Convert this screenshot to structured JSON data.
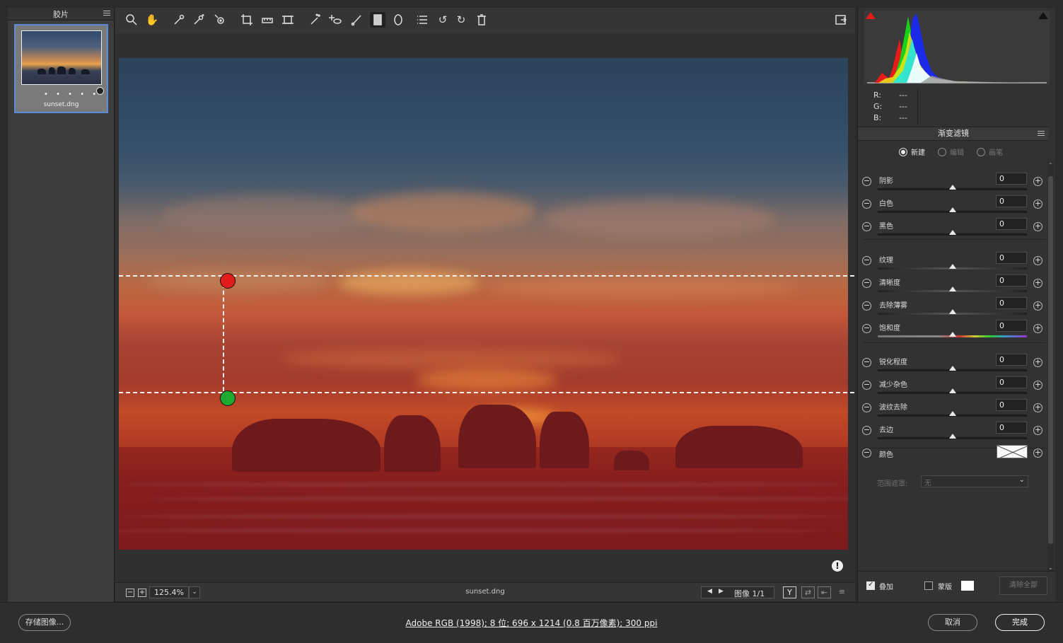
{
  "filmstrip": {
    "title": "胶片",
    "thumbnail": {
      "filename": "sunset.dng",
      "rating_dots": "• • • • •"
    }
  },
  "toolbar": {
    "tools": [
      {
        "name": "zoom-tool"
      },
      {
        "name": "hand-tool"
      },
      {
        "name": "white-balance-tool"
      },
      {
        "name": "color-sampler-tool"
      },
      {
        "name": "targeted-adjustment-tool"
      },
      {
        "name": "crop-tool"
      },
      {
        "name": "straighten-tool"
      },
      {
        "name": "transform-tool"
      },
      {
        "name": "spot-removal-tool"
      },
      {
        "name": "red-eye-tool"
      },
      {
        "name": "adjustment-brush-tool"
      },
      {
        "name": "graduated-filter-tool",
        "active": true
      },
      {
        "name": "radial-filter-tool"
      },
      {
        "name": "preferences-tool"
      },
      {
        "name": "rotate-left-tool"
      },
      {
        "name": "rotate-right-tool"
      },
      {
        "name": "delete-tool"
      }
    ]
  },
  "canvas": {
    "gradient": {
      "start_color": "#e21b1b",
      "end_color": "#1eaa2e"
    }
  },
  "statusbar": {
    "zoom": "125.4%",
    "filename": "sunset.dng",
    "image_counter": "图像 1/1",
    "view_mode_label": "Y"
  },
  "right_panel": {
    "rgb": {
      "r_label": "R:",
      "g_label": "G:",
      "b_label": "B:",
      "r": "---",
      "g": "---",
      "b": "---"
    },
    "panel_title": "渐变滤镜",
    "modes": [
      {
        "label": "新建",
        "selected": true
      },
      {
        "label": "编辑",
        "selected": false
      },
      {
        "label": "画笔",
        "selected": false
      }
    ],
    "sliders": [
      {
        "label": "阴影",
        "value": "0",
        "track": "plain"
      },
      {
        "label": "白色",
        "value": "0",
        "track": "plain"
      },
      {
        "label": "黑色",
        "value": "0",
        "track": "plain"
      },
      {
        "label": "纹理",
        "value": "0",
        "track": "tex"
      },
      {
        "label": "清晰度",
        "value": "0",
        "track": "tex"
      },
      {
        "label": "去除薄雾",
        "value": "0",
        "track": "tex"
      },
      {
        "label": "饱和度",
        "value": "0",
        "track": "sat"
      },
      {
        "label": "锐化程度",
        "value": "0",
        "track": "plain"
      },
      {
        "label": "减少杂色",
        "value": "0",
        "track": "plain"
      },
      {
        "label": "波纹去除",
        "value": "0",
        "track": "plain"
      },
      {
        "label": "去边",
        "value": "0",
        "track": "plain"
      }
    ],
    "color_label": "颜色",
    "range_mask_label": "范围遮罩:",
    "range_mask_value": "无",
    "footer": {
      "overlay_label": "叠加",
      "overlay_checked": true,
      "mask_label": "蒙版",
      "mask_checked": false,
      "clear_all_label": "清除全部"
    }
  },
  "bottom_bar": {
    "save_label": "存储图像...",
    "workflow_options": "Adobe RGB (1998); 8 位; 696 x 1214 (0.8 百万像素); 300 ppi",
    "cancel_label": "取消",
    "done_label": "完成"
  }
}
